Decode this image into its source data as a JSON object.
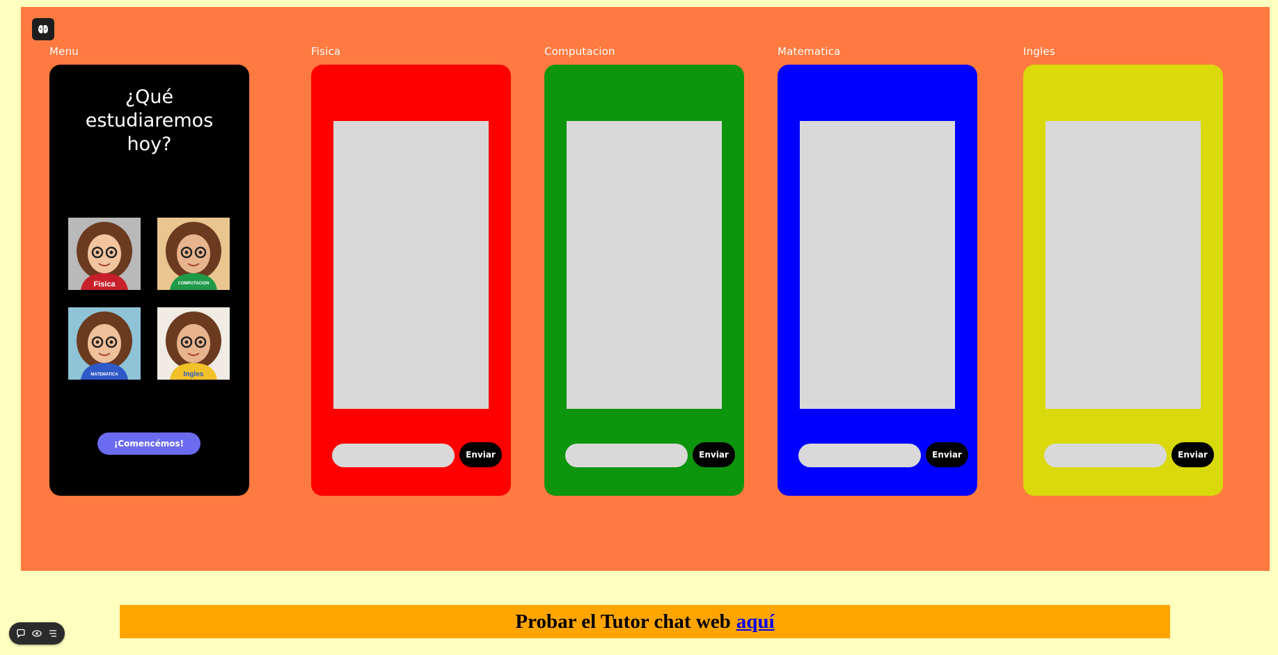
{
  "canvas": {
    "background": "#ff7a40",
    "logo_icon": "brain-icon"
  },
  "frames": {
    "menu": {
      "label": "Menu",
      "title": "¿Qué estudiaremos hoy?",
      "avatars": [
        {
          "subject": "fisica",
          "shirt_text": "Fisica",
          "shirt_color": "#c8202a",
          "bg": "#b9b9b9"
        },
        {
          "subject": "computacion",
          "shirt_text": "COMPUTACION",
          "shirt_color": "#1e9a48",
          "bg": "#e9c58f"
        },
        {
          "subject": "matematica",
          "shirt_text": "MATEMATICA",
          "shirt_color": "#2f59c8",
          "bg": "#8fc3d6"
        },
        {
          "subject": "ingles",
          "shirt_text": "Ingles",
          "shirt_color": "#f2c12a",
          "bg": "#f0ece4"
        }
      ],
      "start_button": "¡Comencémos!",
      "start_button_color": "#6b6bef"
    },
    "fisica": {
      "label": "Fisica",
      "color": "#ff0000",
      "send": "Enviar"
    },
    "computacion": {
      "label": "Computacion",
      "color": "#0d950d",
      "send": "Enviar"
    },
    "matematica": {
      "label": "Matematica",
      "color": "#0000ff",
      "send": "Enviar"
    },
    "ingles": {
      "label": "Ingles",
      "color": "#d9d90b",
      "send": "Enviar"
    }
  },
  "banner": {
    "text": "Probar el Tutor chat web",
    "link_text": "aquí",
    "background": "#ffa500"
  },
  "toolbar": {
    "icons": [
      "comment-icon",
      "eye-icon",
      "list-icon"
    ]
  }
}
